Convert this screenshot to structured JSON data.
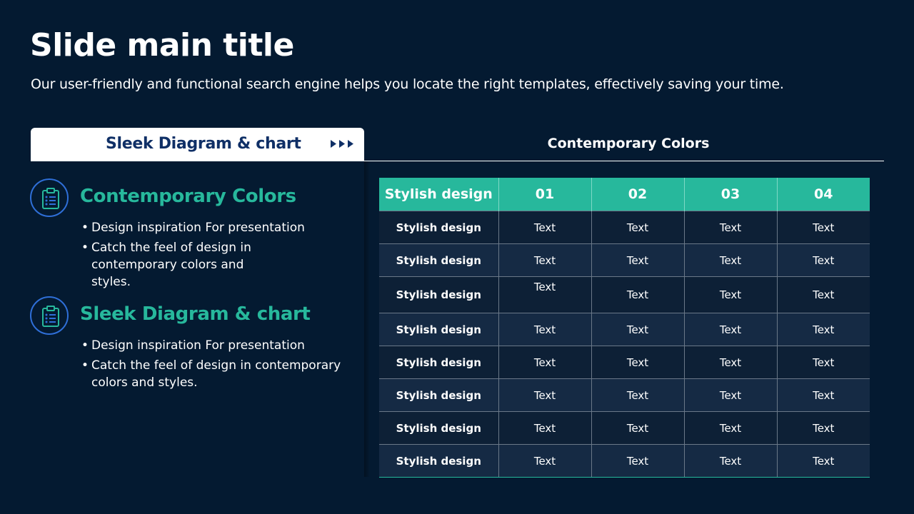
{
  "slide": {
    "title": "Slide main title",
    "subtitle": "Our user-friendly and functional search engine helps you locate the right templates, effectively saving your time."
  },
  "tabs": {
    "left_label": "Sleek Diagram & chart",
    "right_label": "Contemporary  Colors"
  },
  "features": [
    {
      "icon": "clipboard-list-icon",
      "title": "Contemporary Colors",
      "bullets": [
        "Design inspiration For presentation",
        "Catch the feel of design in contemporary colors and styles."
      ]
    },
    {
      "icon": "clipboard-list-icon",
      "title": "Sleek Diagram & chart",
      "bullets": [
        "Design inspiration For presentation",
        "Catch the feel of design in contemporary colors and styles."
      ]
    }
  ],
  "table": {
    "headers": [
      "Stylish  design",
      "01",
      "02",
      "03",
      "04"
    ],
    "rows": [
      [
        "Stylish design",
        "Text",
        "Text",
        "Text",
        "Text"
      ],
      [
        "Stylish design",
        "Text",
        "Text",
        "Text",
        "Text"
      ],
      [
        "Stylish design",
        "Text",
        "Text",
        "Text",
        "Text"
      ],
      [
        "Stylish design",
        "Text",
        "Text",
        "Text",
        "Text"
      ],
      [
        "Stylish design",
        "Text",
        "Text",
        "Text",
        "Text"
      ],
      [
        "Stylish design",
        "Text",
        "Text",
        "Text",
        "Text"
      ],
      [
        "Stylish design",
        "Text",
        "Text",
        "Text",
        "Text"
      ],
      [
        "Stylish design",
        "Text",
        "Text",
        "Text",
        "Text"
      ]
    ]
  },
  "colors": {
    "background": "#041a31",
    "accent": "#27b89c",
    "tab_text": "#0f2f66",
    "icon_ring": "#2f6fd8"
  }
}
